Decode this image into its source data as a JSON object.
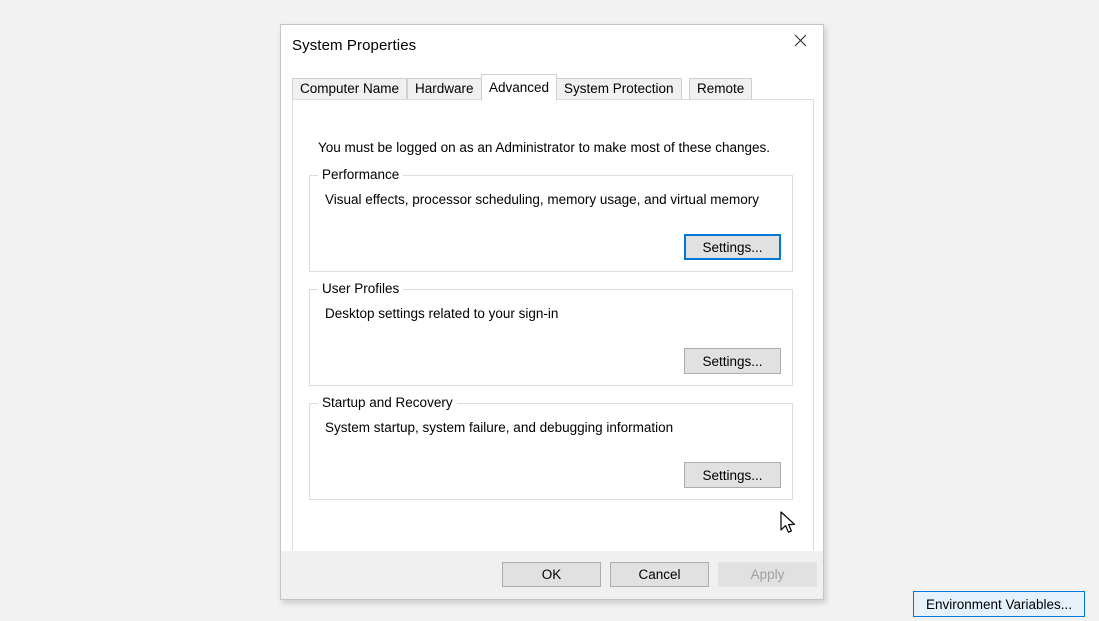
{
  "window": {
    "title": "System Properties",
    "close_icon": "close-icon"
  },
  "tabs": [
    {
      "label": "Computer Name",
      "selected": false
    },
    {
      "label": "Hardware",
      "selected": false
    },
    {
      "label": "Advanced",
      "selected": true
    },
    {
      "label": "System Protection",
      "selected": false
    },
    {
      "label": "Remote",
      "selected": false
    }
  ],
  "panel": {
    "admin_note": "You must be logged on as an Administrator to make most of these changes.",
    "groups": [
      {
        "legend": "Performance",
        "description": "Visual effects, processor scheduling, memory usage, and virtual memory",
        "button_label": "Settings...",
        "button_state": "focused"
      },
      {
        "legend": "User Profiles",
        "description": "Desktop settings related to your sign-in",
        "button_label": "Settings...",
        "button_state": "normal"
      },
      {
        "legend": "Startup and Recovery",
        "description": "System startup, system failure, and debugging information",
        "button_label": "Settings...",
        "button_state": "normal"
      }
    ],
    "environment_variables_button": {
      "label": "Environment Variables...",
      "state": "hovered"
    }
  },
  "footer": {
    "ok_label": "OK",
    "cancel_label": "Cancel",
    "apply_label": "Apply",
    "apply_disabled": true
  },
  "colors": {
    "accent": "#0078d7",
    "hover_fill": "#e5f1fb",
    "button_face": "#e1e1e1",
    "page_background": "#f2f2f2",
    "disabled_text": "#a0a0a0"
  },
  "cursor": {
    "icon": "arrow-pointer-icon"
  }
}
